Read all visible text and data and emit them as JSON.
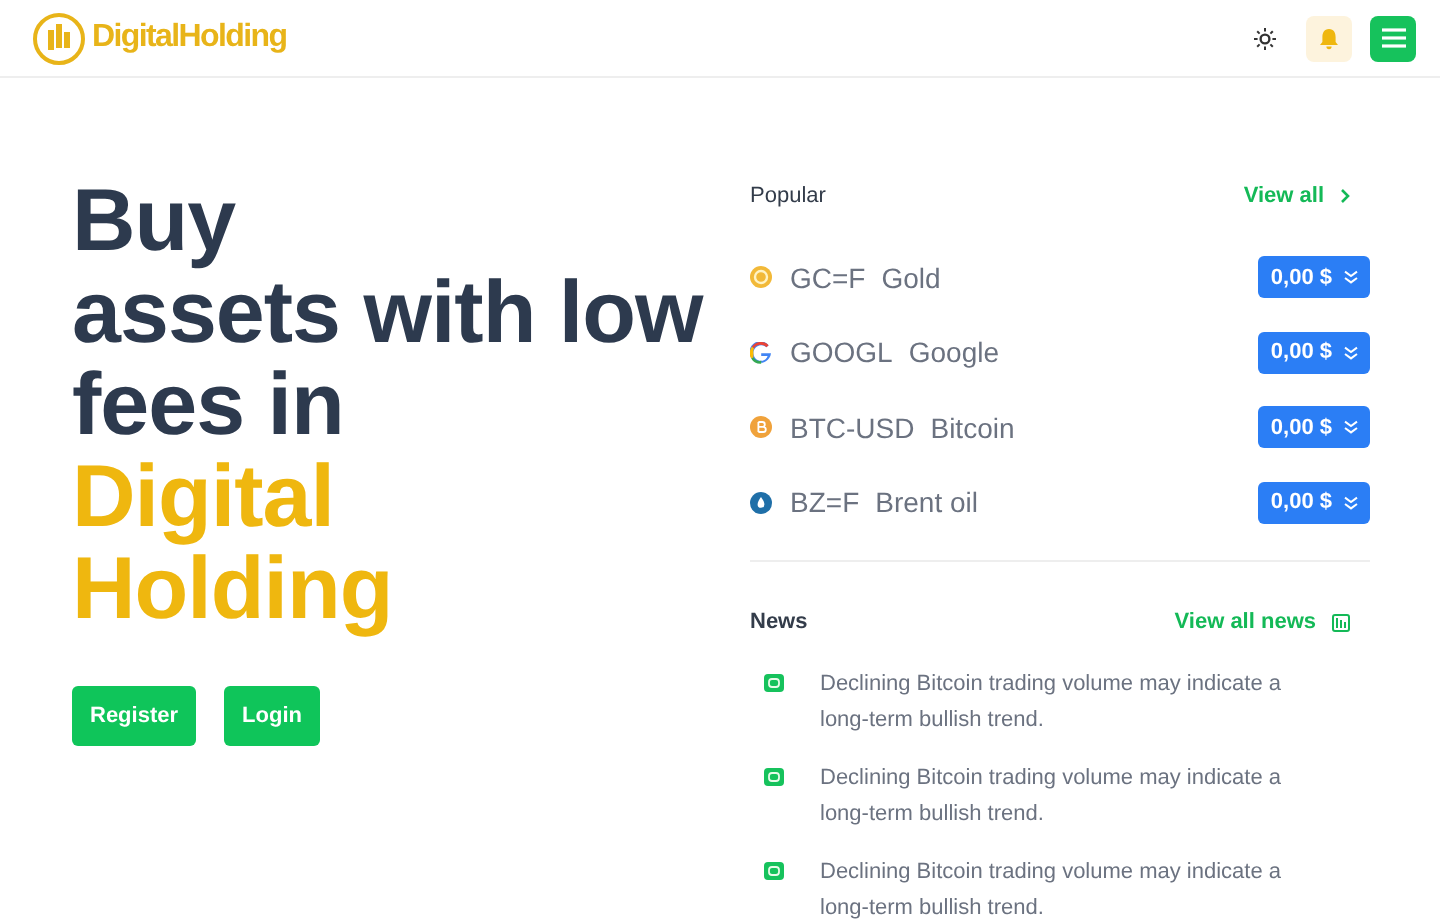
{
  "header": {
    "logo": "DigitalHolding"
  },
  "hero": {
    "title_lines": [
      {
        "text": "Buy",
        "accent": false
      },
      {
        "text": "assets with low",
        "accent": false
      },
      {
        "text": "fees in",
        "accent": false
      },
      {
        "text": "Digital",
        "accent": true
      },
      {
        "text": "Holding",
        "accent": true
      }
    ],
    "buttons": [
      "Register",
      "Login"
    ]
  },
  "popular": {
    "title": "Popular",
    "link": "View all",
    "assets": [
      {
        "kind": "gold",
        "symbol": "GC=F",
        "name": "Gold",
        "price": "0,00 $"
      },
      {
        "kind": "google",
        "symbol": "GOOGL",
        "name": "Google",
        "price": "0,00 $"
      },
      {
        "kind": "bitcoin",
        "symbol": "BTC-USD",
        "name": "Bitcoin",
        "price": "0,00 $"
      },
      {
        "kind": "oil",
        "symbol": "BZ=F",
        "name": "Brent oil",
        "price": "0,00 $"
      }
    ]
  },
  "news": {
    "title": "News",
    "link": "View all news",
    "items": [
      "Declining Bitcoin trading volume may indicate a long-term bullish trend.",
      "Declining Bitcoin trading volume may indicate a long-term bullish trend.",
      "Declining Bitcoin trading volume may indicate a long-term bullish trend."
    ]
  }
}
